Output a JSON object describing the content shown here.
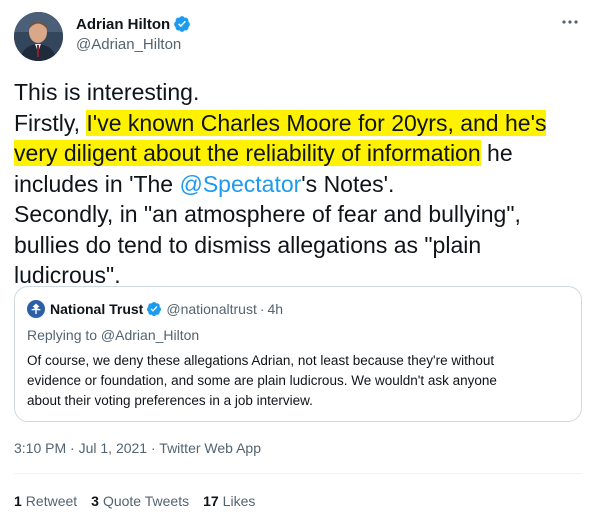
{
  "author": {
    "display_name": "Adrian Hilton",
    "handle": "@Adrian_Hilton"
  },
  "tweet_lines": [
    "This is interesting.",
    "Firstly, ",
    "I've known Charles Moore for 20yrs, and he's",
    "very diligent about the reliability of information",
    " he",
    "includes in 'The ",
    "@Spectator",
    "'s Notes'.",
    "Secondly, in \"an atmosphere of fear and bullying\",",
    "bullies do tend to dismiss allegations as \"plain",
    "ludicrous\"."
  ],
  "quote": {
    "display_name": "National Trust",
    "handle": "@nationaltrust",
    "separator": "·",
    "time": "4h",
    "reply_to": "Replying to @Adrian_Hilton",
    "lines": [
      "Of course, we deny these allegations Adrian, not least because they're without",
      "evidence or foundation, and some are plain ludicrous. We wouldn't ask anyone",
      "about their voting preferences in a job interview."
    ]
  },
  "meta": {
    "time": "3:10 PM",
    "date": "Jul 1, 2021",
    "source": "Twitter Web App",
    "sep": " · "
  },
  "stats": {
    "retweets_count": "1",
    "retweets_label": "Retweet",
    "quotes_count": "3",
    "quotes_label": "Quote Tweets",
    "likes_count": "17",
    "likes_label": "Likes"
  },
  "colors": {
    "highlight": "#fff200",
    "link": "#1d9bf0",
    "verified": "#1d9bf0",
    "secondary_text": "#536471",
    "nt_logo": "#2d5fa6"
  },
  "icons": [
    "avatar-photo",
    "verified-badge-icon",
    "more-options-icon",
    "national-trust-logo-icon"
  ]
}
